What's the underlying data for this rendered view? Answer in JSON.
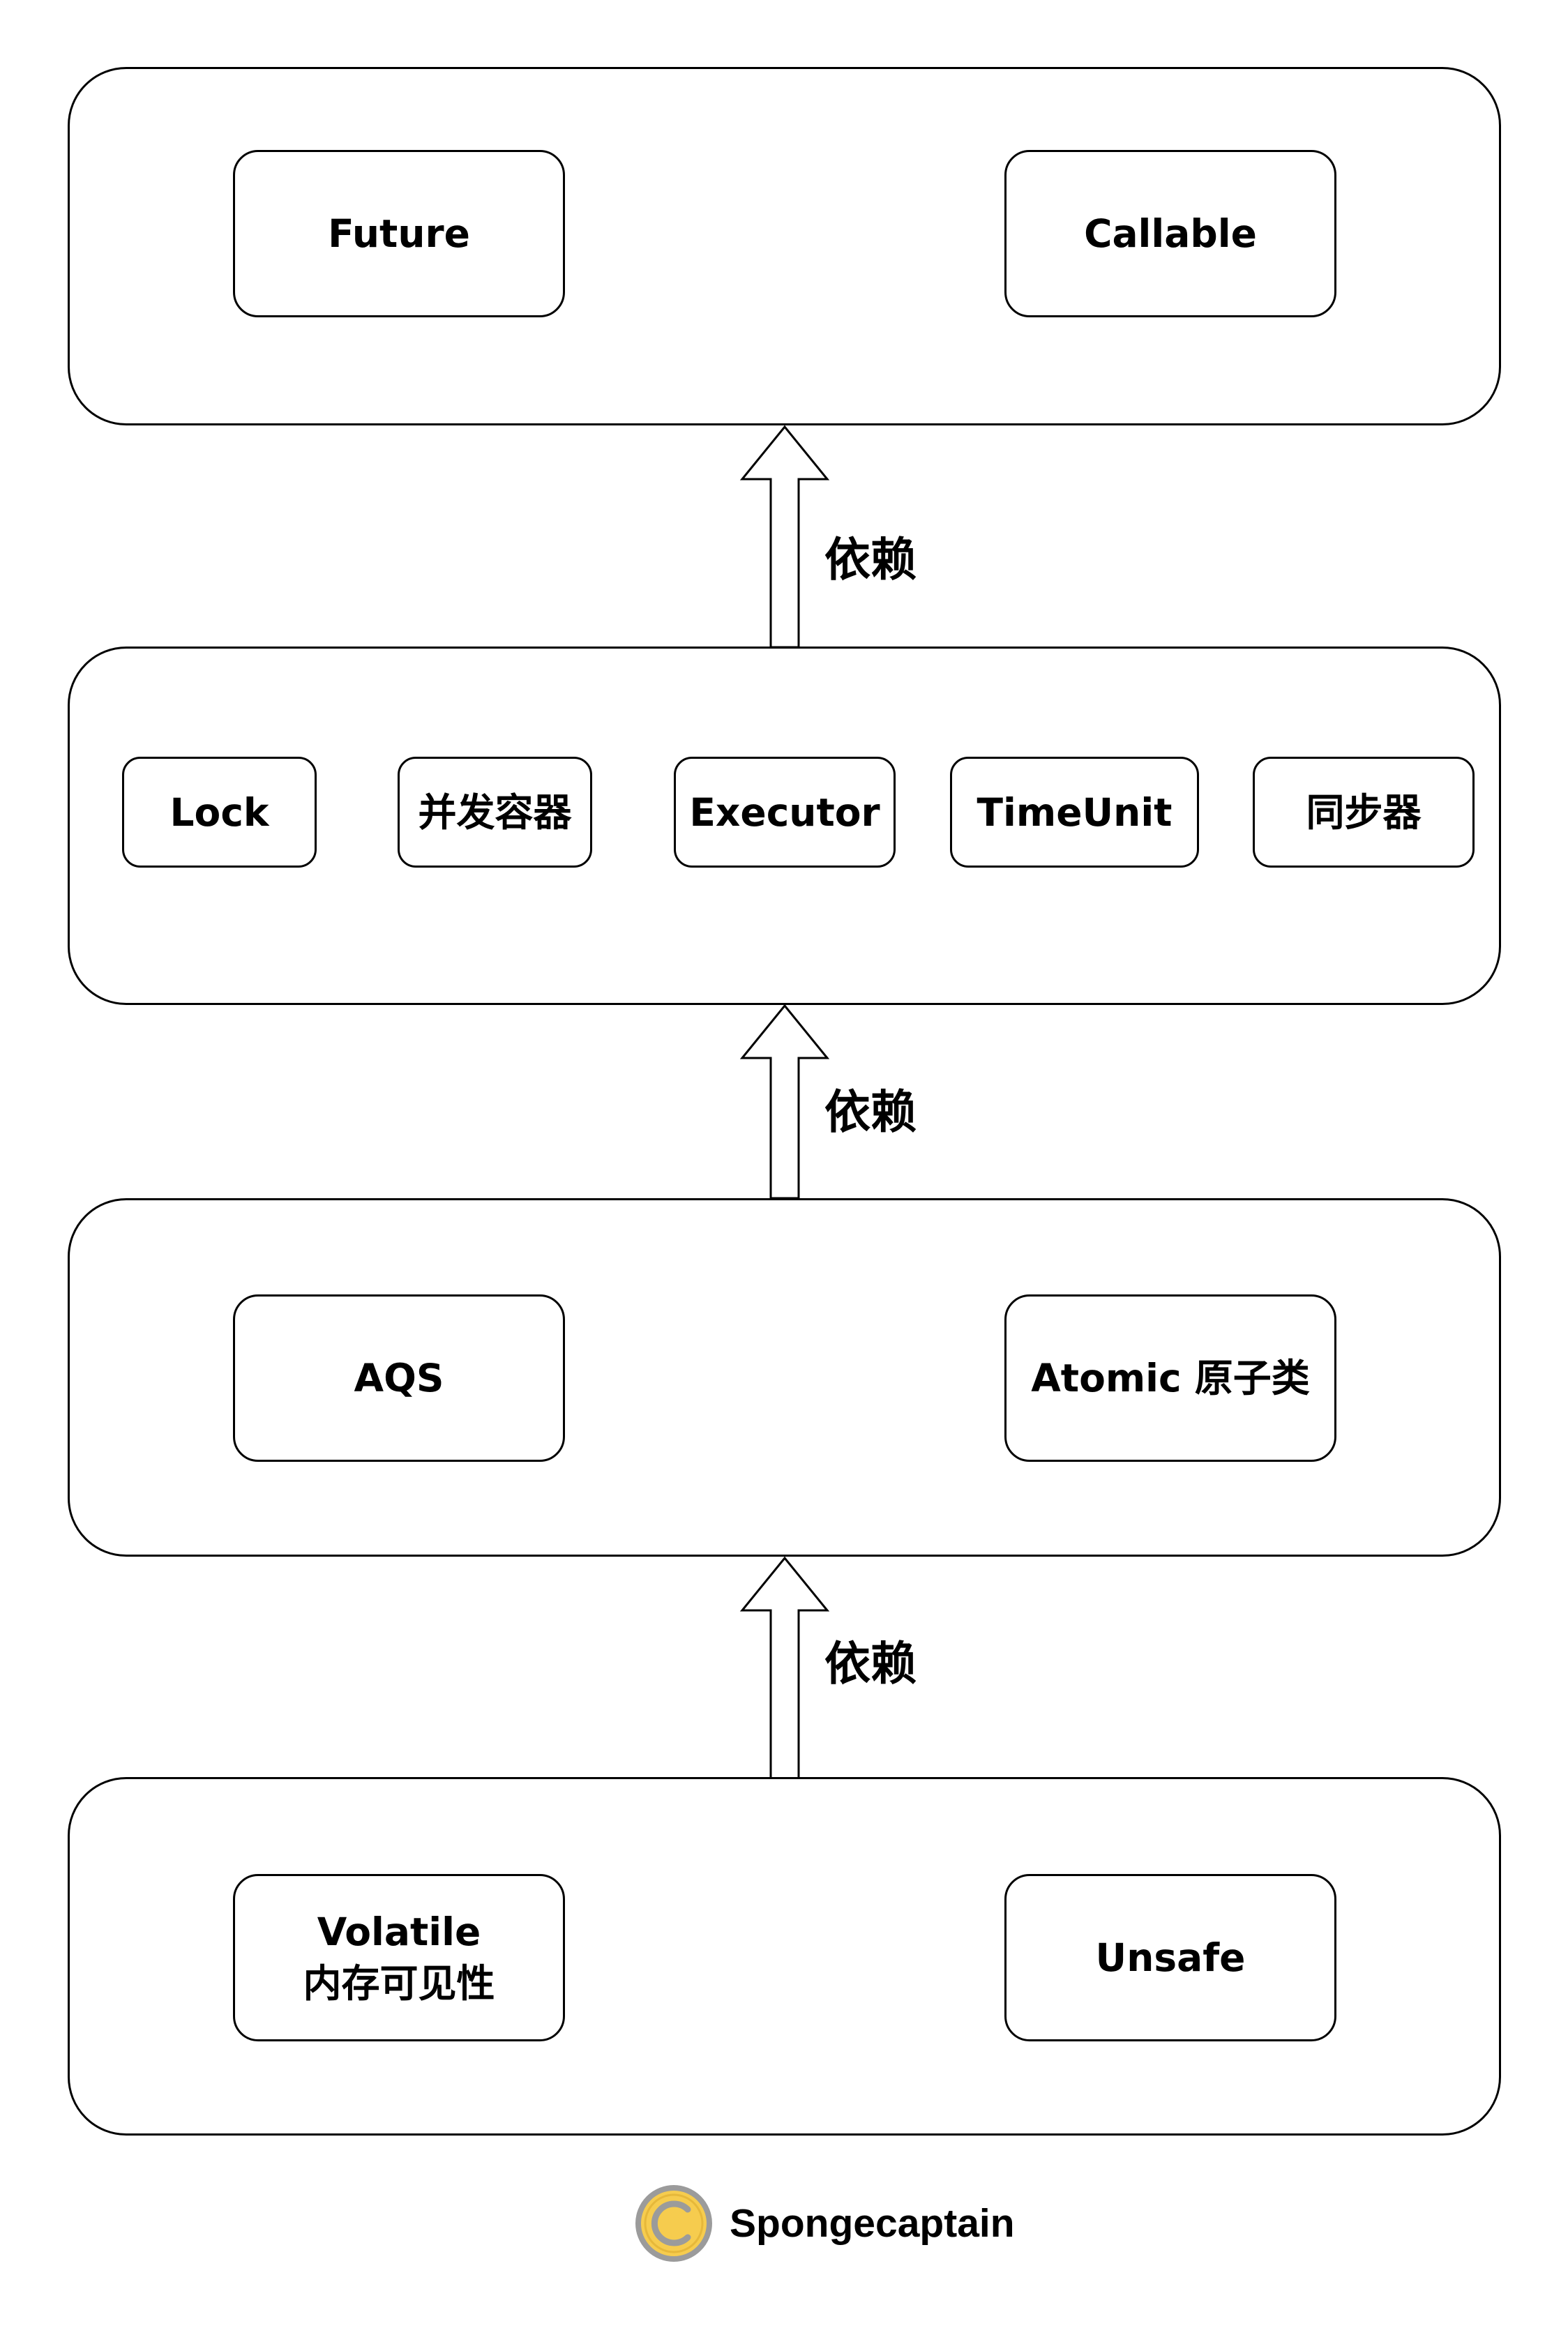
{
  "layers": [
    {
      "boxes": [
        {
          "lines": [
            "Future"
          ]
        },
        {
          "lines": [
            "Callable"
          ]
        }
      ]
    },
    {
      "boxes": [
        {
          "lines": [
            "Lock"
          ]
        },
        {
          "lines": [
            "并发容器"
          ]
        },
        {
          "lines": [
            "Executor"
          ]
        },
        {
          "lines": [
            "TimeUnit"
          ]
        },
        {
          "lines": [
            "同步器"
          ]
        }
      ]
    },
    {
      "boxes": [
        {
          "lines": [
            "AQS"
          ]
        },
        {
          "lines": [
            "Atomic 原子类"
          ]
        }
      ]
    },
    {
      "boxes": [
        {
          "lines": [
            "Volatile",
            "内存可见性"
          ]
        },
        {
          "lines": [
            "Unsafe"
          ]
        }
      ]
    }
  ],
  "arrows": [
    {
      "label": "依赖"
    },
    {
      "label": "依赖"
    },
    {
      "label": "依赖"
    }
  ],
  "watermark": {
    "text": "Spongecaptain",
    "logo_icon": "copyright-c-logo-icon",
    "logo_color": "#f6cc4e",
    "logo_ring_color": "#9b9b9b"
  }
}
